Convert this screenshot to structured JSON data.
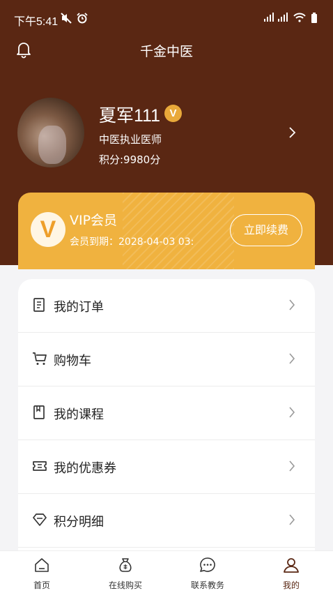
{
  "status_bar": {
    "time": "下午5:41",
    "icons": [
      "mute-icon",
      "alarm-icon",
      "signal-icon",
      "signal-icon",
      "wifi-icon",
      "battery-icon"
    ]
  },
  "header": {
    "title": "千金中医",
    "left_icon": "bell-icon"
  },
  "profile": {
    "name": "夏军111",
    "verified_badge": "V",
    "title": "中医执业医师",
    "points": "积分:9980分"
  },
  "vip": {
    "logo_letter": "V",
    "title": "VIP会员",
    "expire_text": "会员到期：2028-04-03 03:",
    "renew_label": "立即续费"
  },
  "menu": {
    "items": [
      {
        "label": "我的订单",
        "icon": "order-list-icon"
      },
      {
        "label": "购物车",
        "icon": "cart-icon"
      },
      {
        "label": "我的课程",
        "icon": "course-book-icon"
      },
      {
        "label": "我的优惠券",
        "icon": "coupon-icon"
      },
      {
        "label": "积分明细",
        "icon": "diamond-icon"
      }
    ]
  },
  "tabbar": {
    "tabs": [
      {
        "label": "首页",
        "icon": "home-icon",
        "active": false
      },
      {
        "label": "在线购买",
        "icon": "money-bag-icon",
        "active": false
      },
      {
        "label": "联系教务",
        "icon": "chat-icon",
        "active": false
      },
      {
        "label": "我的",
        "icon": "user-icon",
        "active": true
      }
    ]
  },
  "colors": {
    "header_bg": "#5a2713",
    "vip_card_bg": "#f0b23f",
    "verified_badge": "#e9a93a",
    "page_bg": "#f4f4f6",
    "active_tab": "#5a2713"
  }
}
